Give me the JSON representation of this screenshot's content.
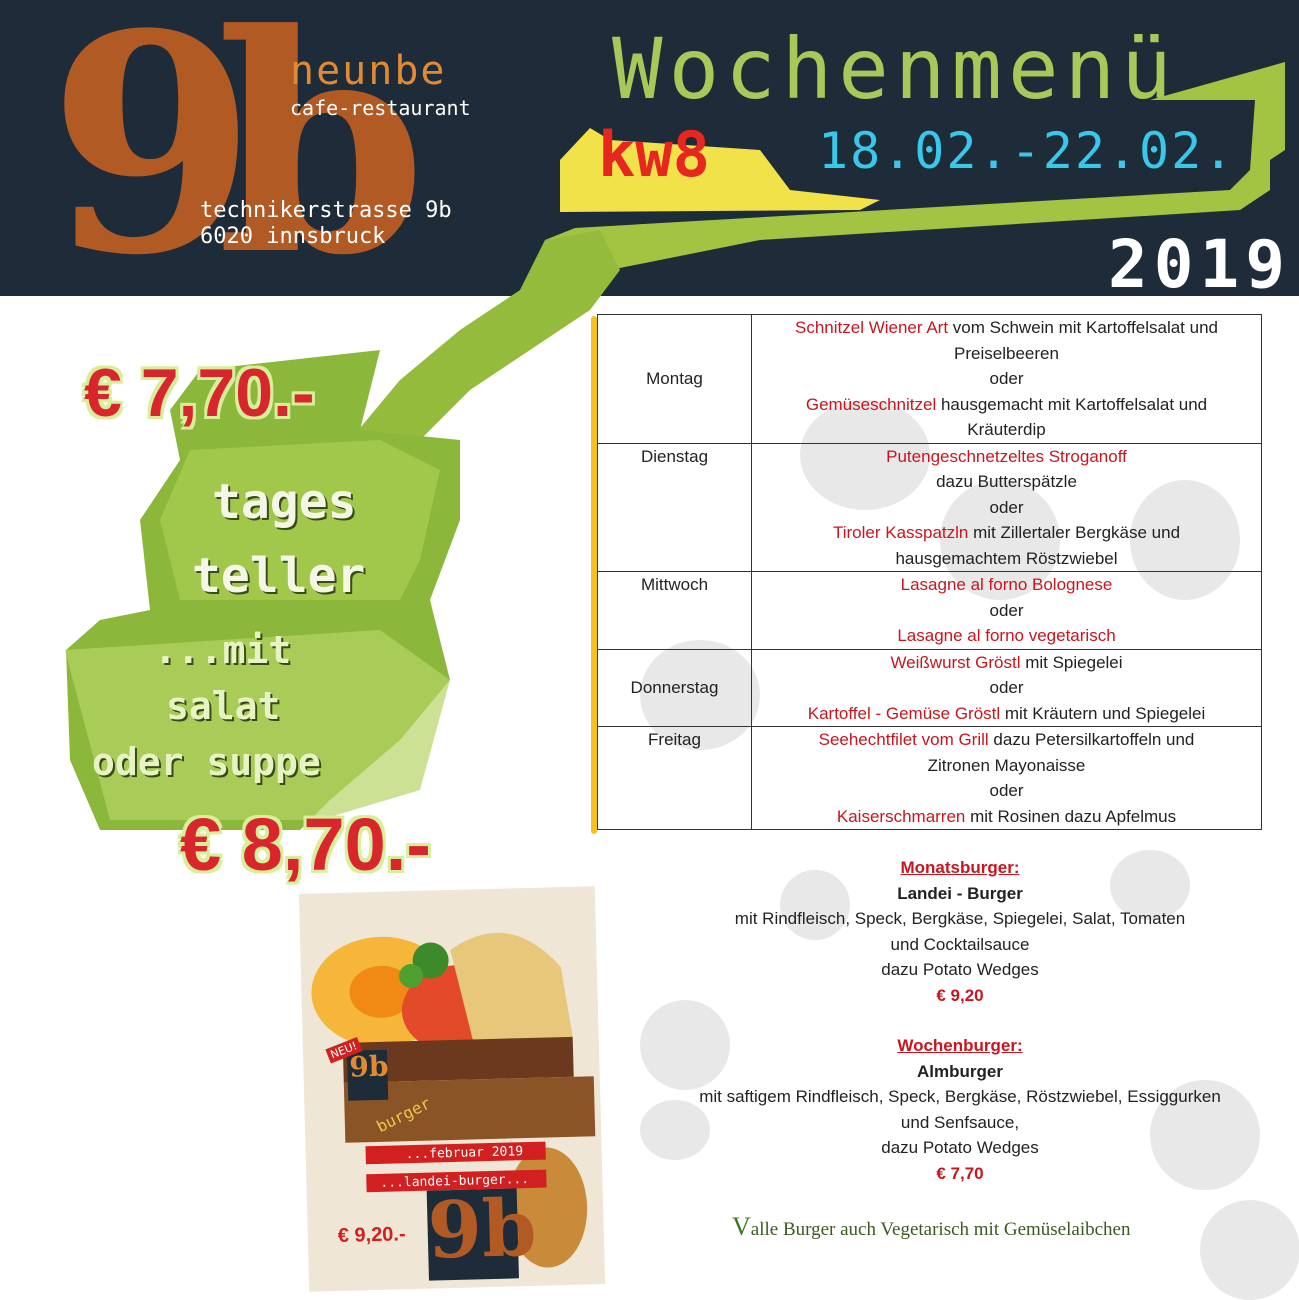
{
  "header": {
    "logo": "9b",
    "brand_name": "neunbe",
    "brand_sub": "cafe-restaurant",
    "address_line1": "technikerstrasse 9b",
    "address_line2": "6020 innsbruck",
    "title": "Wochenmenü",
    "week": "kw8",
    "dates": "18.02.-22.02.",
    "year": "2019"
  },
  "left_panel": {
    "price_top": "€ 7,70.-",
    "line1": "tages",
    "line2": "teller",
    "line3": "...mit",
    "line4": "salat",
    "line5": "oder suppe",
    "price_bottom": "€ 8,70.-"
  },
  "menu": {
    "days": [
      {
        "day": "Montag",
        "lines": [
          {
            "red": "Schnitzel Wiener Art",
            "rest": " vom Schwein mit Kartoffelsalat und"
          },
          {
            "red": "",
            "rest": "Preiselbeeren"
          },
          {
            "red": "",
            "rest": "oder"
          },
          {
            "red": "Gemüseschnitzel",
            "rest": " hausgemacht mit Kartoffelsalat und"
          },
          {
            "red": "",
            "rest": "Kräuterdip"
          }
        ]
      },
      {
        "day": "Dienstag",
        "lines": [
          {
            "red": "Putengeschnetzeltes Stroganoff",
            "rest": ""
          },
          {
            "red": "",
            "rest": "dazu Butterspätzle"
          },
          {
            "red": "",
            "rest": "oder"
          },
          {
            "red": "Tiroler Kasspatzln",
            "rest": " mit Zillertaler Bergkäse und"
          },
          {
            "red": "",
            "rest": "hausgemachtem Röstzwiebel"
          }
        ]
      },
      {
        "day": "Mittwoch",
        "lines": [
          {
            "red": "Lasagne al forno Bolognese",
            "rest": ""
          },
          {
            "red": "",
            "rest": "oder"
          },
          {
            "red": "Lasagne al forno vegetarisch",
            "rest": ""
          }
        ]
      },
      {
        "day": "Donnerstag",
        "lines": [
          {
            "red": "Weißwurst Gröstl",
            "rest": " mit Spiegelei"
          },
          {
            "red": "",
            "rest": "oder"
          },
          {
            "red": "Kartoffel - Gemüse Gröstl",
            "rest": " mit Kräutern und Spiegelei"
          }
        ]
      },
      {
        "day": "Freitag",
        "lines": [
          {
            "red": "Seehechtfilet vom Grill",
            "rest": " dazu Petersilkartoffeln und"
          },
          {
            "red": "",
            "rest": "Zitronen Mayonaisse"
          },
          {
            "red": "",
            "rest": "oder"
          },
          {
            "red": "Kaiserschmarren",
            "rest": " mit Rosinen dazu Apfelmus"
          }
        ]
      }
    ]
  },
  "burgers": {
    "monthly_head": "Monatsburger:",
    "monthly_name": "Landei - Burger",
    "monthly_desc1": "mit  Rindfleisch, Speck, Bergkäse, Spiegelei, Salat, Tomaten",
    "monthly_desc2": "und Cocktailsauce",
    "monthly_desc3": "dazu Potato Wedges",
    "monthly_price": "€ 9,20",
    "weekly_head": "Wochenburger:",
    "weekly_name": "Almburger",
    "weekly_desc1": "mit saftigem Rindfleisch, Speck, Bergkäse, Röstzwiebel, Essiggurken",
    "weekly_desc2": "und Senfsauce,",
    "weekly_desc3": "dazu Potato Wedges",
    "weekly_price": "€ 7,70",
    "veg_mark": "V",
    "veg_note": "alle Burger auch Vegetarisch mit Gemüselaibchen"
  },
  "poster": {
    "badge": "NEU!",
    "burger_word": "burger",
    "month": "...februar 2019",
    "item": "...landei-burger...",
    "price": "€ 9,20.-",
    "logo": "9b"
  }
}
